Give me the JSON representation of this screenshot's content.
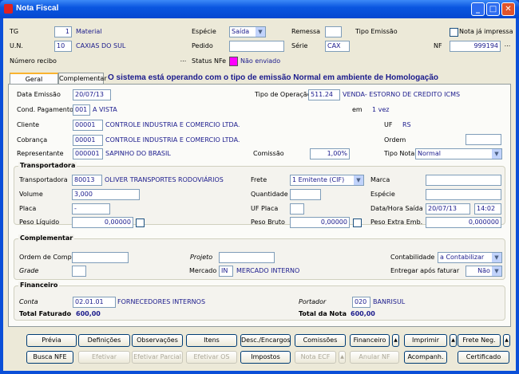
{
  "window": {
    "title": "Nota Fiscal"
  },
  "header": {
    "tg_label": "TG",
    "tg_value": "1",
    "tg_desc": "Material",
    "especie_label": "Espécie",
    "especie_value": "Saída",
    "remessa_label": "Remessa",
    "remessa_value": "",
    "tipo_emissao_label": "Tipo Emissão",
    "nota_impressa_label": "Nota já impressa",
    "un_label": "U.N.",
    "un_value": "10",
    "un_desc": "CAXIAS DO SUL",
    "pedido_label": "Pedido",
    "pedido_value": "",
    "serie_label": "Série",
    "serie_value": "CAX",
    "nf_label": "NF",
    "nf_value": "999194",
    "recibo_label": "Número recibo",
    "status_label": "Status NFe",
    "status_value": "Não enviado",
    "status_color": "#ff00ff",
    "dots": "..."
  },
  "tabs": [
    {
      "label": "Geral"
    },
    {
      "label": "Complementar"
    }
  ],
  "message": "O sistema está operando com o tipo de emissão Normal em ambiente de Homologação",
  "geral": {
    "data_emissao_label": "Data Emissão",
    "data_emissao": "20/07/13",
    "tipo_op_label": "Tipo de Operação",
    "tipo_op": "511.24",
    "tipo_op_desc": "VENDA- ESTORNO DE CREDITO ICMS",
    "cond_label": "Cond. Pagamento",
    "cond": "001",
    "cond_desc": "A VISTA",
    "em_label": "em",
    "em_value": "1 vez",
    "cliente_label": "Cliente",
    "cliente": "00001",
    "cliente_desc": "CONTROLE INDUSTRIA E COMERCIO LTDA.",
    "uf_label": "UF",
    "uf": "RS",
    "cobranca_label": "Cobrança",
    "cobranca": "00001",
    "cobranca_desc": "CONTROLE INDUSTRIA E COMERCIO LTDA.",
    "ordem_label": "Ordem",
    "ordem": "",
    "rep_label": "Representante",
    "rep": "000001",
    "rep_desc": "SAPINHO DO BRASIL",
    "comissao_label": "Comissão",
    "comissao": "1,00%",
    "tipo_nota_label": "Tipo Nota",
    "tipo_nota": "Normal"
  },
  "transportadora": {
    "title": "Transportadora",
    "transp_label": "Transportadora",
    "transp": "80013",
    "transp_desc": "OLIVER TRANSPORTES RODOVIÁRIOS",
    "volume_label": "Volume",
    "volume": "3,000",
    "placa_label": "Placa",
    "placa": "-",
    "peso_liq_label": "Peso Líquido",
    "peso_liq": "0,00000",
    "frete_label": "Frete",
    "frete": "1 Emitente (CIF)",
    "quantidade_label": "Quantidade",
    "quantidade": "",
    "uf_placa_label": "UF Placa",
    "uf_placa": "",
    "peso_bruto_label": "Peso Bruto",
    "peso_bruto": "0,00000",
    "marca_label": "Marca",
    "marca": "",
    "especie_label": "Espécie",
    "especie": "",
    "saida_label": "Data/Hora Saída",
    "saida_data": "20/07/13",
    "saida_hora": "14:02",
    "peso_extra_label": "Peso Extra Emb.",
    "peso_extra": "0,000000"
  },
  "complementar": {
    "title": "Complementar",
    "ordem_compra_label": "Ordem de Compra",
    "ordem_compra": "",
    "projeto_label": "Projeto",
    "projeto": "",
    "contabilidade_label": "Contabilidade",
    "contabilidade": "a Contabilizar",
    "grade_label": "Grade",
    "grade": "",
    "mercado_label": "Mercado",
    "mercado": "IN",
    "mercado_desc": "MERCADO INTERNO",
    "entregar_label": "Entregar após faturar",
    "entregar": "Não"
  },
  "financeiro": {
    "title": "Financeiro",
    "conta_label": "Conta",
    "conta": "02.01.01",
    "conta_desc": "FORNECEDORES INTERNOS",
    "portador_label": "Portador",
    "portador": "020",
    "portador_desc": "BANRISUL",
    "total_faturado_label": "Total Faturado",
    "total_faturado": "600,00",
    "total_nota_label": "Total da Nota",
    "total_nota": "600,00"
  },
  "buttons": {
    "previa": "Prévia",
    "definicoes": "Definições",
    "observacoes": "Observações",
    "itens": "Itens",
    "desc_encargos": "Desc./Encargos",
    "comissoes": "Comissões",
    "financeiro": "Financeiro",
    "imprimir": "Imprimir",
    "frete_neg": "Frete Neg.",
    "busca_nfe": "Busca NFE",
    "efetivar": "Efetivar",
    "efetivar_parcial": "Efetivar Parcial",
    "efetivar_os": "Efetivar OS",
    "impostos": "Impostos",
    "nota_ecf": "Nota ECF",
    "anular_nf": "Anular NF",
    "acompanh": "Acompanh.",
    "certificado": "Certificado",
    "arrow": "▲"
  }
}
